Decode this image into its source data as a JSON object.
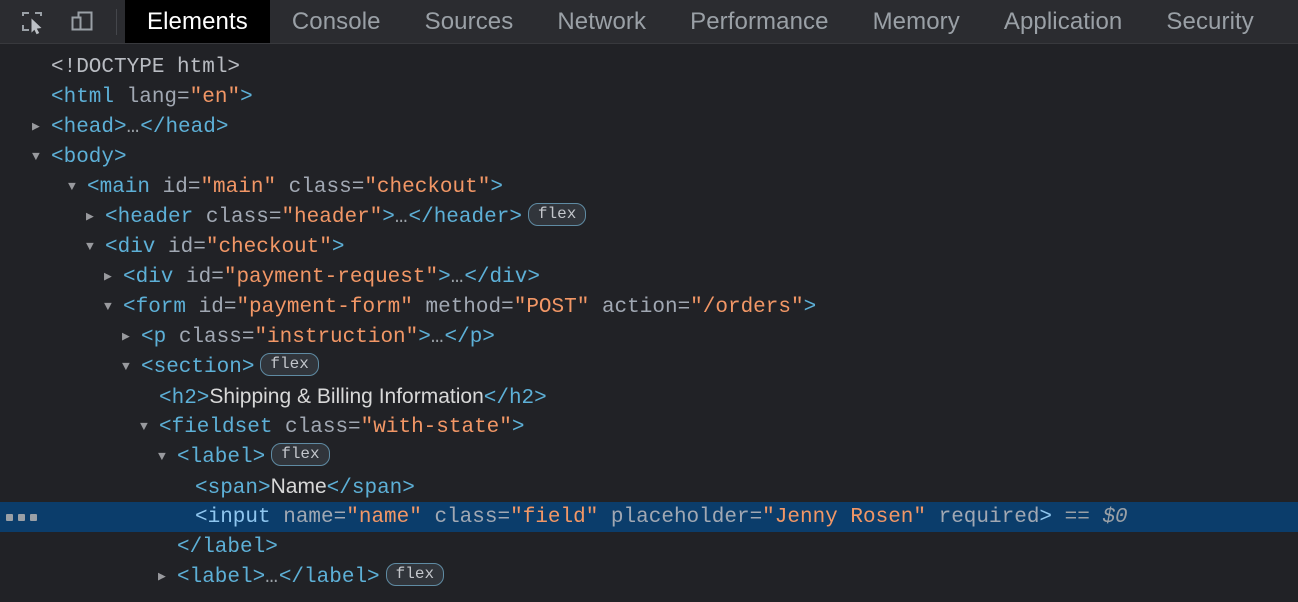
{
  "toolbar": {
    "inspect_icon": "inspect-element-icon",
    "device_icon": "device-toolbar-icon",
    "tabs": [
      {
        "label": "Elements",
        "active": true
      },
      {
        "label": "Console",
        "active": false
      },
      {
        "label": "Sources",
        "active": false
      },
      {
        "label": "Network",
        "active": false
      },
      {
        "label": "Performance",
        "active": false
      },
      {
        "label": "Memory",
        "active": false
      },
      {
        "label": "Application",
        "active": false
      },
      {
        "label": "Security",
        "active": false
      }
    ]
  },
  "colors": {
    "panel_bg": "#212226",
    "toolbar_bg": "#2b2c30",
    "active_tab_bg": "#000000",
    "selected_row_bg": "#0b3d6b",
    "tag": "#5db0d7",
    "attr_name": "#a1a8b3",
    "attr_value": "#f29766",
    "text_node": "#d8d8d8",
    "badge_border": "#5f8ba3"
  },
  "dom": {
    "line1": {
      "doctype": "<!DOCTYPE html>"
    },
    "line2": {
      "open": "<html ",
      "attr": "lang",
      "eq": "=",
      "val": "\"en\"",
      "close": ">"
    },
    "line3": {
      "tag": "<head>",
      "ellipsis": "…",
      "closetag": "</head>"
    },
    "line4": {
      "tag": "<body>"
    },
    "line5": {
      "open": "<main ",
      "attr1": "id",
      "val1": "\"main\"",
      "attr2": " class",
      "val2": "\"checkout\"",
      "close": ">"
    },
    "line6": {
      "open": "<header ",
      "attr1": "class",
      "val1": "\"header\"",
      "close": ">",
      "ellipsis": "…",
      "closetag": "</header>",
      "badge": "flex"
    },
    "line7": {
      "open": "<div ",
      "attr1": "id",
      "val1": "\"checkout\"",
      "close": ">"
    },
    "line8": {
      "open": "<div ",
      "attr1": "id",
      "val1": "\"payment-request\"",
      "close": ">",
      "ellipsis": "…",
      "closetag": "</div>"
    },
    "line9": {
      "open": "<form ",
      "attr1": "id",
      "val1": "\"payment-form\"",
      "attr2": " method",
      "val2": "\"POST\"",
      "attr3": " action",
      "val3": "\"/orders\"",
      "close": ">"
    },
    "line10": {
      "open": "<p ",
      "attr1": "class",
      "val1": "\"instruction\"",
      "close": ">",
      "ellipsis": "…",
      "closetag": "</p>"
    },
    "line11": {
      "tag": "<section>",
      "badge": "flex"
    },
    "line12": {
      "opentag": "<h2>",
      "text": "Shipping & Billing Information",
      "closetag": "</h2>"
    },
    "line13": {
      "open": "<fieldset ",
      "attr1": "class",
      "val1": "\"with-state\"",
      "close": ">"
    },
    "line14": {
      "tag": "<label>",
      "badge": "flex"
    },
    "line15": {
      "opentag": "<span>",
      "text": "Name",
      "closetag": "</span>"
    },
    "line16": {
      "open": "<input ",
      "attr1": "name",
      "val1": "\"name\"",
      "attr2": " class",
      "val2": "\"field\"",
      "attr3": " placeholder",
      "val3": "\"Jenny Rosen\"",
      "attr4": " required",
      "close": ">",
      "selected_marker": "== $0"
    },
    "line17": {
      "tag": "</label>"
    },
    "line18": {
      "tag": "<label>",
      "ellipsis": "…",
      "closetag": "</label>",
      "badge": "flex"
    }
  }
}
